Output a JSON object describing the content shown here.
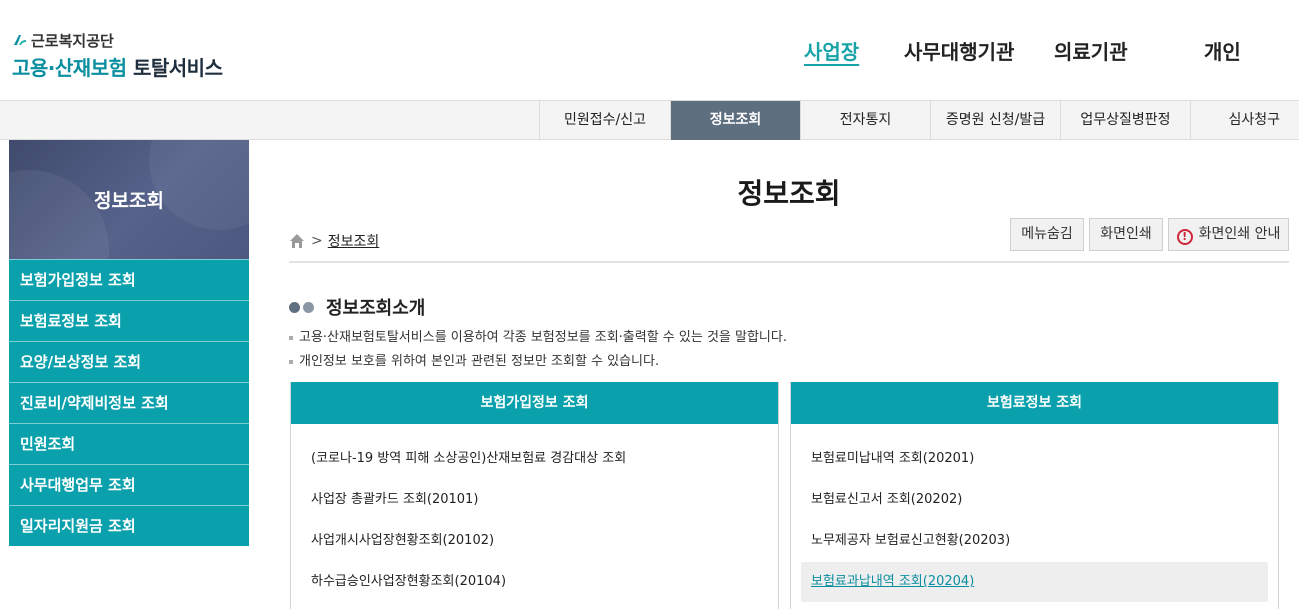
{
  "logo": {
    "org": "근로복지공단",
    "title_teal": "고용·산재보험",
    "title_dark": "토탈서비스"
  },
  "top_nav": [
    {
      "label": "사업장",
      "active": true
    },
    {
      "label": "사무대행기관",
      "active": false
    },
    {
      "label": "의료기관",
      "active": false
    },
    {
      "label": "개인",
      "active": false
    }
  ],
  "sub_nav": [
    {
      "label": "민원접수/신고",
      "active": false
    },
    {
      "label": "정보조회",
      "active": true
    },
    {
      "label": "전자통지",
      "active": false
    },
    {
      "label": "증명원 신청/발급",
      "active": false
    },
    {
      "label": "업무상질병판정",
      "active": false
    },
    {
      "label": "심사청구",
      "active": false
    }
  ],
  "sidebar": {
    "title": "정보조회",
    "items": [
      {
        "label": "보험가입정보 조회"
      },
      {
        "label": "보험료정보 조회"
      },
      {
        "label": "요양/보상정보 조회"
      },
      {
        "label": "진료비/약제비정보 조회"
      },
      {
        "label": "민원조회"
      },
      {
        "label": "사무대행업무 조회"
      },
      {
        "label": "일자리지원금 조회"
      }
    ]
  },
  "main": {
    "page_title": "정보조회",
    "breadcrumb": {
      "current": "정보조회"
    },
    "buttons": {
      "hide_menu": "메뉴숨김",
      "print": "화면인쇄",
      "print_guide": "화면인쇄 안내"
    },
    "intro": {
      "title": "정보조회소개",
      "lines": [
        "고용·산재보험토탈서비스를 이용하여 각종 보험정보를 조회·출력할 수 있는 것을 말합니다.",
        "개인정보 보호를 위하여 본인과 관련된 정보만 조회할 수 있습니다."
      ]
    },
    "panels": [
      {
        "title": "보험가입정보 조회",
        "items": [
          {
            "label": "(코로나-19 방역 피해 소상공인)산재보험료 경감대상 조회"
          },
          {
            "label": "사업장 총괄카드 조회(20101)"
          },
          {
            "label": "사업개시사업장현황조회(20102)"
          },
          {
            "label": "하수급승인사업장현황조회(20104)"
          }
        ]
      },
      {
        "title": "보험료정보 조회",
        "items": [
          {
            "label": "보험료미납내역 조회(20201)"
          },
          {
            "label": "보험료신고서 조회(20202)"
          },
          {
            "label": "노무제공자 보험료신고현황(20203)"
          },
          {
            "label": "보험료과납내역 조회(20204)"
          }
        ]
      }
    ]
  },
  "colors": {
    "teal": "#0aa0ac",
    "slate": "#5e6f80",
    "active_link": "#17a3a8",
    "warning": "#d0263a"
  }
}
